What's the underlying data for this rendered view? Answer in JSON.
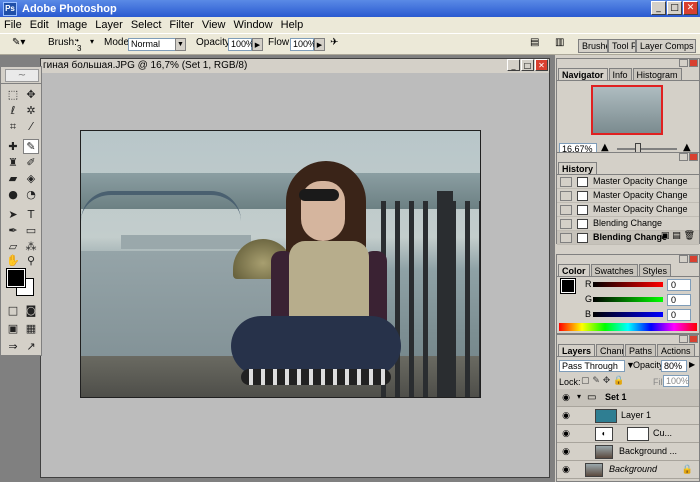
{
  "app": {
    "title": "Adobe Photoshop"
  },
  "menu": [
    "File",
    "Edit",
    "Image",
    "Layer",
    "Select",
    "Filter",
    "View",
    "Window",
    "Help"
  ],
  "options": {
    "brush_label": "Brush:",
    "brush_size": "3",
    "mode_label": "Mode:",
    "mode_value": "Normal",
    "opacity_label": "Opacity:",
    "opacity_value": "100%",
    "flow_label": "Flow:",
    "flow_value": "100%"
  },
  "well_tabs": [
    "Brushes",
    "Tool Pr",
    "Layer Comps"
  ],
  "document": {
    "title": "гиная большая.JPG @ 16,7% (Set 1, RGB/8)"
  },
  "navigator": {
    "tabs": [
      "Navigator",
      "Info",
      "Histogram"
    ],
    "zoom": "16,67%"
  },
  "history": {
    "tab": "History",
    "items": [
      {
        "label": "Master Opacity Change",
        "selected": false
      },
      {
        "label": "Master Opacity Change",
        "selected": false
      },
      {
        "label": "Master Opacity Change",
        "selected": false
      },
      {
        "label": "Blending Change",
        "selected": false
      },
      {
        "label": "Blending Change",
        "selected": true
      }
    ]
  },
  "color": {
    "tabs": [
      "Color",
      "Swatches",
      "Styles"
    ],
    "r_label": "R",
    "r_value": "0",
    "g_label": "G",
    "g_value": "0",
    "b_label": "B",
    "b_value": "0"
  },
  "layers": {
    "tabs": [
      "Layers",
      "Channels",
      "Paths",
      "Actions"
    ],
    "blend_mode": "Pass Through",
    "opacity_label": "Opacity:",
    "opacity_value": "80%",
    "lock_label": "Lock:",
    "fill_label": "Fill:",
    "fill_value": "100%",
    "items": [
      {
        "name": "Set 1"
      },
      {
        "name": "Layer 1"
      },
      {
        "name": "Cu..."
      },
      {
        "name": "Background ..."
      },
      {
        "name": "Background"
      }
    ]
  },
  "colors": {
    "accent_close": "#d84030",
    "titlebar": "#2a5ad0",
    "layer1_thumb": "#2f7e92"
  }
}
